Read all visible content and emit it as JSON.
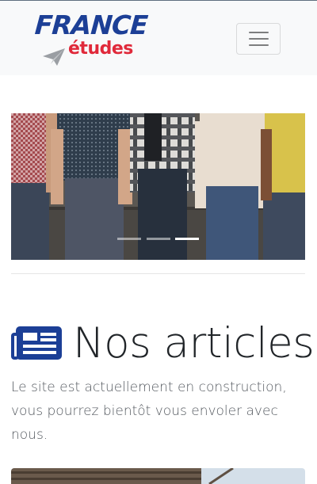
{
  "colors": {
    "navbar_bg": "#f8f9fa",
    "brand_blue": "#1c3f96",
    "brand_red": "#e0293a",
    "heading_icon": "#1c3f96",
    "text": "#212529",
    "lead_text": "#555a60"
  },
  "navbar": {
    "brand": {
      "line1": "FRANCE",
      "line2": "études",
      "icon": "paper-plane-icon"
    },
    "toggler_icon": "hamburger-menu-icon"
  },
  "carousel": {
    "slide_count": 3,
    "active_slide": 3
  },
  "section": {
    "icon": "newspaper-icon",
    "title": "Nos articles",
    "lead": "Le site est actuellement en construction, vous pourrez bientôt vous envoler avec nous."
  }
}
